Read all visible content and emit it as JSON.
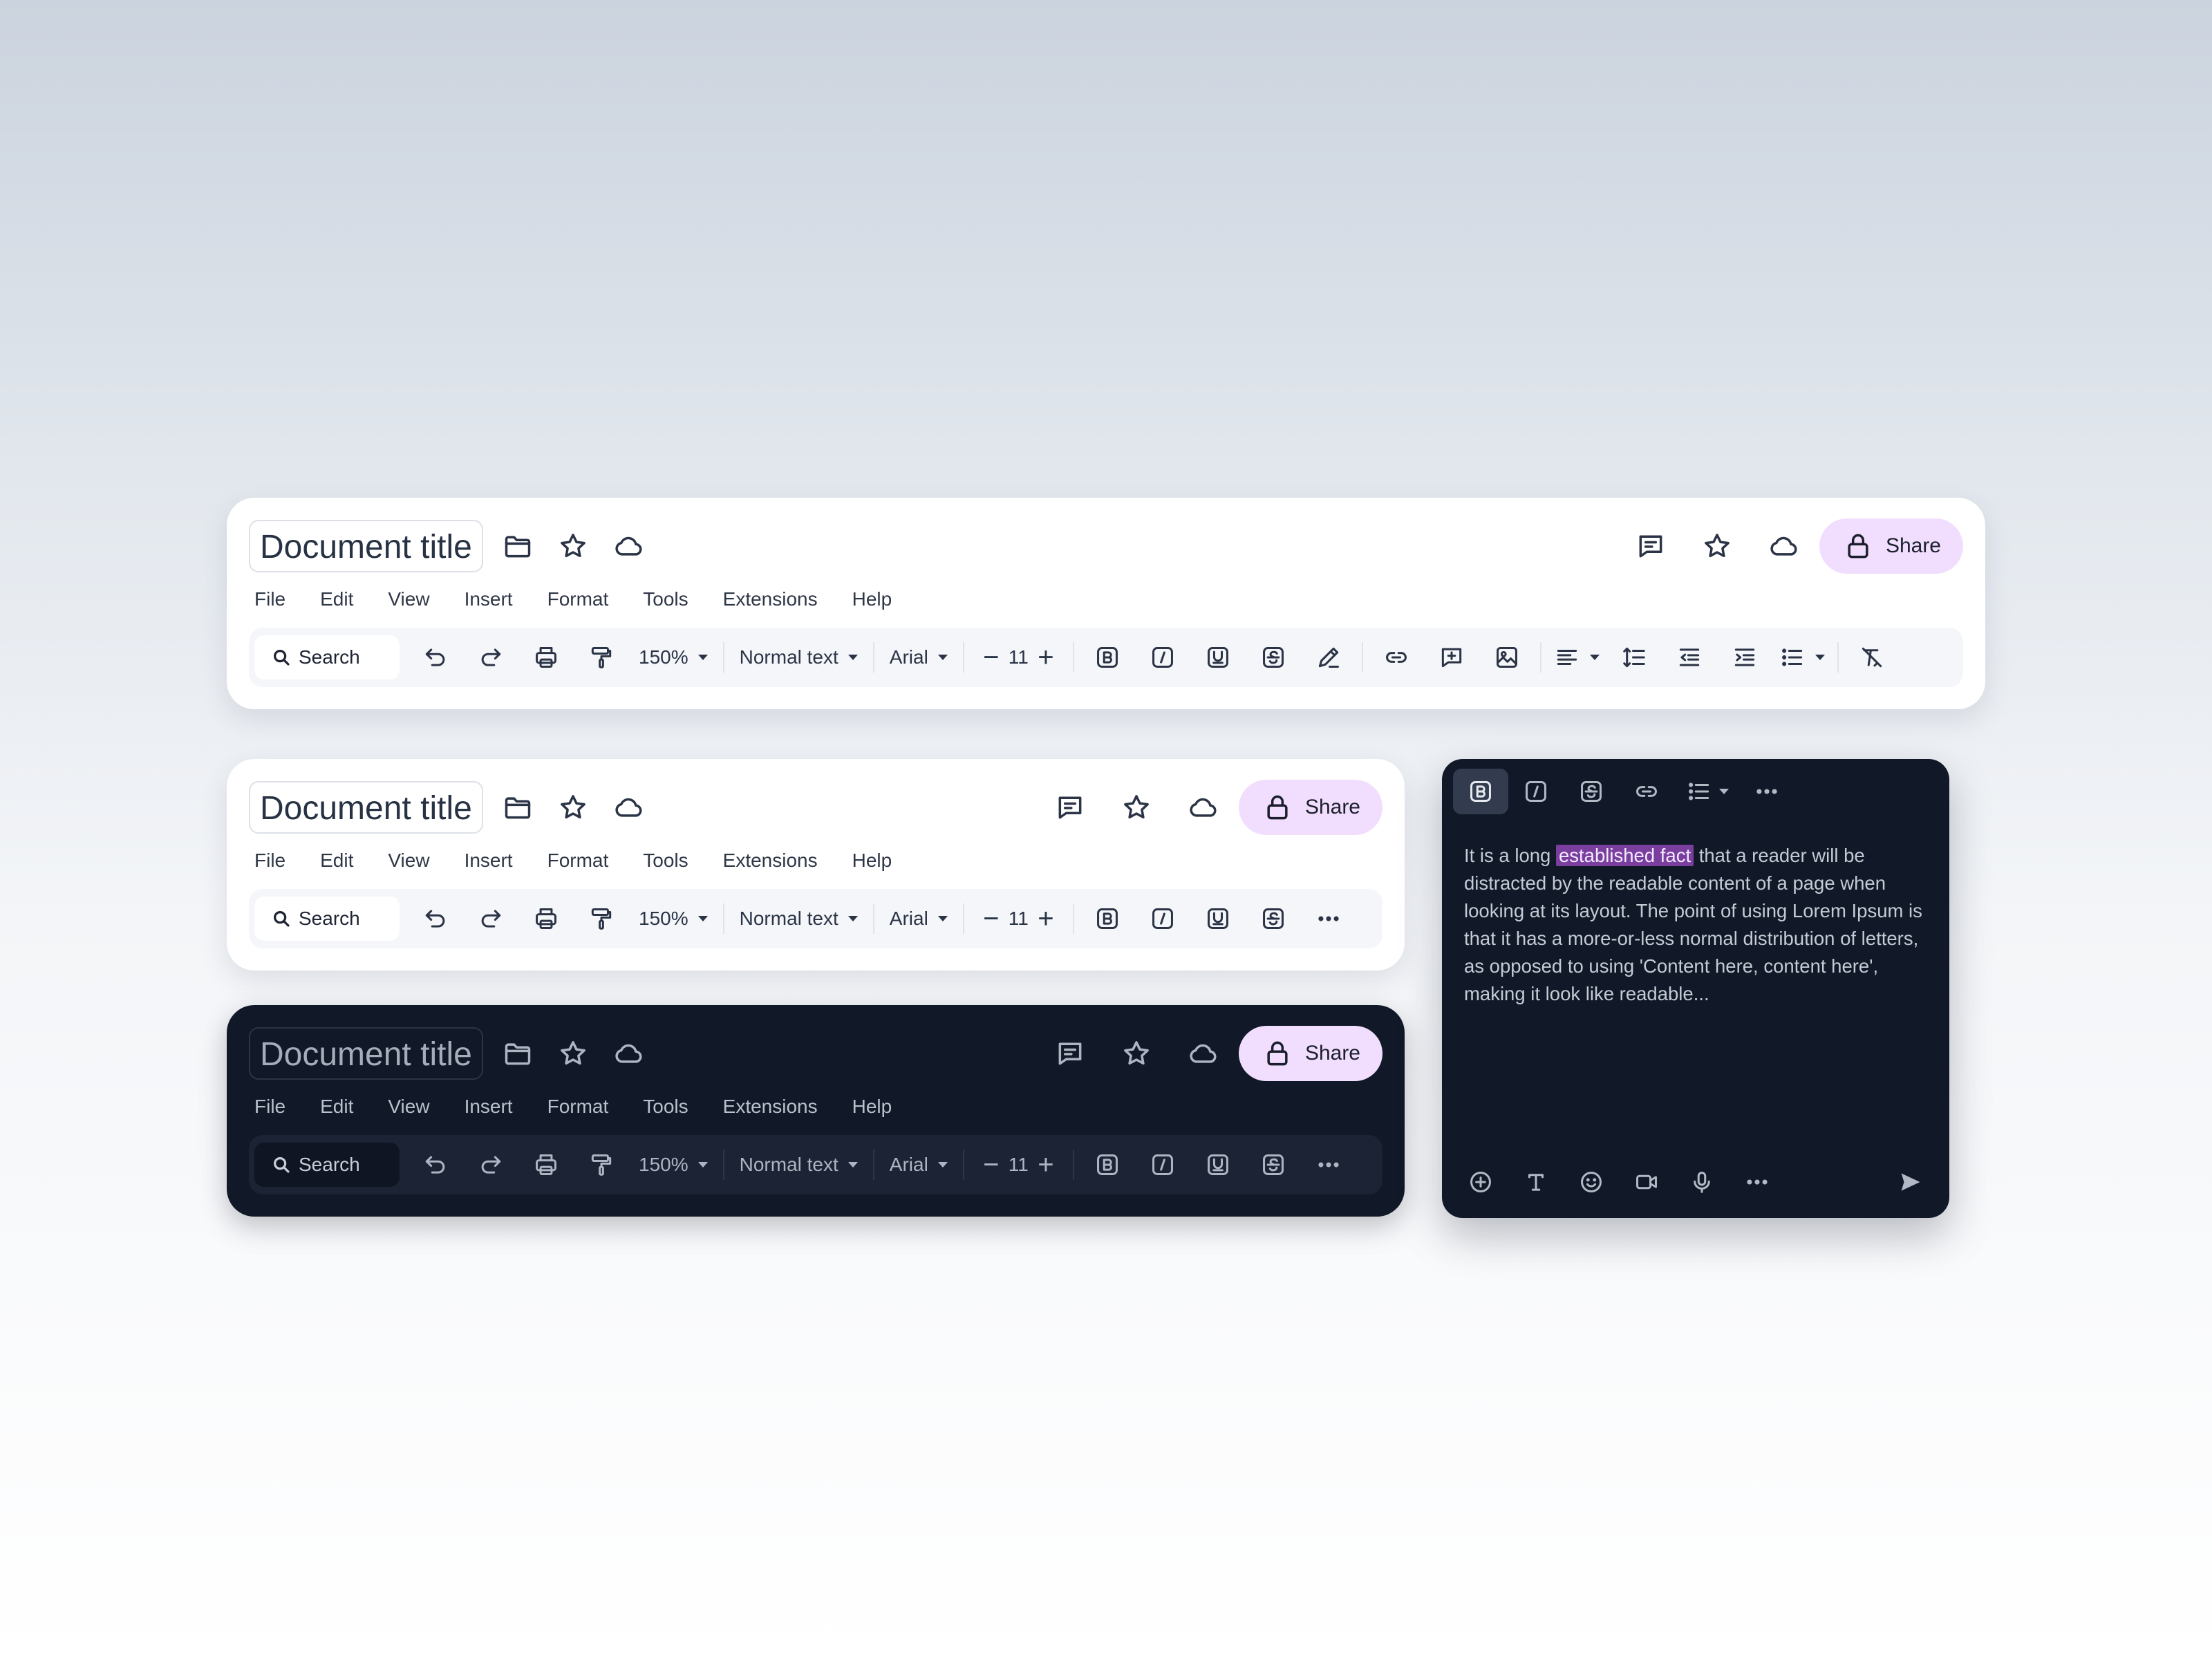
{
  "doc": {
    "title": "Document title",
    "share_label": "Share",
    "search_placeholder": "Search",
    "zoom": "150%",
    "style": "Normal text",
    "font": "Arial",
    "font_size": "11"
  },
  "menu": [
    "File",
    "Edit",
    "View",
    "Insert",
    "Format",
    "Tools",
    "Extensions",
    "Help"
  ],
  "editor": {
    "text_before": "It is a long ",
    "highlight": "established fact",
    "text_after": " that a reader will be distracted by the readable content of a page when looking at its layout. The point of using Lorem Ipsum is that it has a more-or-less normal distribution of letters, as opposed to using 'Content here, content here', making it look like readable..."
  },
  "colors": {
    "share_bg": "#f1deff",
    "dark_bg": "#111827",
    "highlight": "#7a3f9e"
  }
}
